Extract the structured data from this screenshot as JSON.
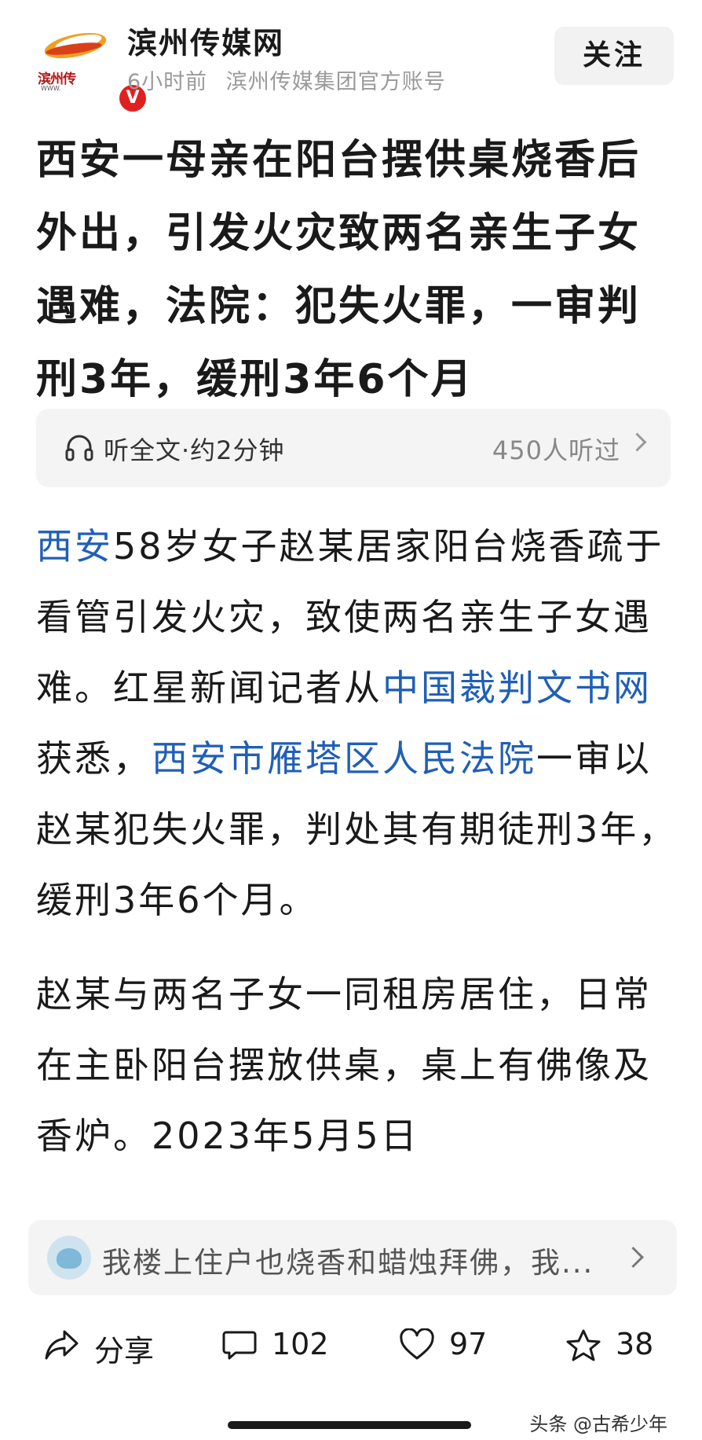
{
  "header": {
    "logo_text": "滨州传",
    "logo_sub": "WWW.",
    "logo_badge": "V",
    "source_name": "滨州传媒网",
    "time": "6小时前",
    "account_desc": "滨州传媒集团官方账号",
    "follow_label": "关注"
  },
  "title": "西安一母亲在阳台摆供桌烧香后外出，引发火灾致两名亲生子女遇难，法院：犯失火罪，一审判刑3年，缓刑3年6个月",
  "listen": {
    "icon": "headphone-icon",
    "label": "听全文·约2分钟",
    "count": "450人听过"
  },
  "article": {
    "p1": [
      {
        "text": "西安",
        "link": true
      },
      {
        "text": "58岁女子赵某居家阳台烧香疏于看管引发火灾，致使两名亲生子女遇难。红星新闻记者从",
        "link": false
      },
      {
        "text": "中国裁判文书网",
        "link": true
      },
      {
        "text": "获悉，",
        "link": false
      },
      {
        "text": "西安市雁塔区人民法院",
        "link": true
      },
      {
        "text": "一审以赵某犯失火罪，判处其有期徒刑3年，缓刑3年6个月。",
        "link": false
      }
    ],
    "p2": "赵某与两名子女一同租房居住，日常在主卧阳台摆放供桌，桌上有佛像及香炉。2023年5月5日"
  },
  "comment_preview": {
    "text": "我楼上住户也烧香和蜡烛拜佛，我..."
  },
  "actions": {
    "share_label": "分享",
    "comment_count": "102",
    "like_count": "97",
    "fav_count": "38"
  },
  "watermark": "头条 @古希少年",
  "colors": {
    "link": "#1f5fb8",
    "accent_red": "#e02020"
  }
}
